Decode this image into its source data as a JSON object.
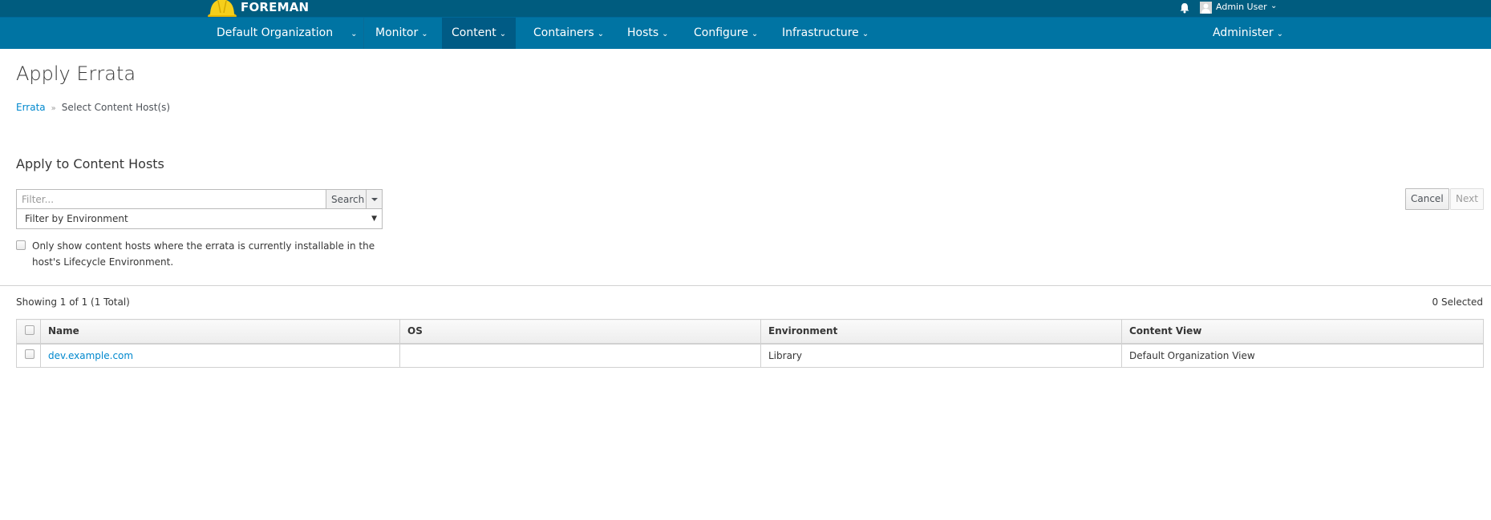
{
  "header": {
    "brand": "FOREMAN",
    "user": "Admin User",
    "icons": {
      "notifications": "bell-icon",
      "user_menu": "chevron-down-icon"
    }
  },
  "nav": {
    "items": [
      {
        "label": "Default Organization",
        "active": false
      },
      {
        "label": "Monitor",
        "active": false
      },
      {
        "label": "Content",
        "active": true
      },
      {
        "label": "Containers",
        "active": false
      },
      {
        "label": "Hosts",
        "active": false
      },
      {
        "label": "Configure",
        "active": false
      },
      {
        "label": "Infrastructure",
        "active": false
      }
    ],
    "right": {
      "label": "Administer"
    }
  },
  "page": {
    "title": "Apply Errata",
    "breadcrumb": {
      "parent": "Errata",
      "separator": "»",
      "current": "Select Content Host(s)"
    },
    "section_title": "Apply to Content Hosts"
  },
  "filters": {
    "search_placeholder": "Filter...",
    "search_value": "",
    "search_button": "Search",
    "environment_select": "Filter by Environment",
    "only_installable_label": "Only show content hosts where the errata is currently installable in the host's Lifecycle Environment.",
    "only_installable_checked": false
  },
  "actions": {
    "cancel": "Cancel",
    "next": "Next"
  },
  "table": {
    "showing": "Showing 1 of 1 (1 Total)",
    "selected": "0 Selected",
    "columns": [
      "Name",
      "OS",
      "Environment",
      "Content View"
    ],
    "rows": [
      {
        "name": "dev.example.com",
        "os": "",
        "environment": "Library",
        "content_view": "Default Organization View",
        "checked": false
      }
    ]
  },
  "colors": {
    "topbar": "#005c7f",
    "navbar": "#0074a3",
    "nav_active": "#005b85",
    "link": "#0088ce"
  }
}
